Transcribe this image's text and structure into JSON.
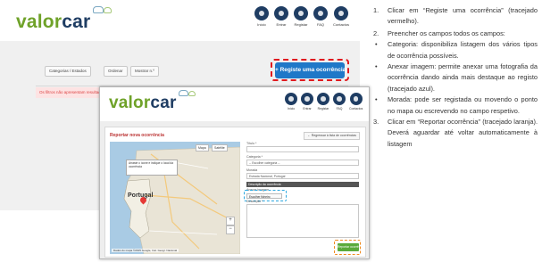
{
  "colors": {
    "logo_green": "#6fa229",
    "logo_navy": "#1f3d63",
    "register_button": "#1f78c8",
    "red_highlight": "#e0191f",
    "blue_highlight": "#2da8e0",
    "orange_highlight": "#f08a1c",
    "report_button": "#5aaa3c"
  },
  "screenshot_back": {
    "logo_left": "valor",
    "logo_right": "car",
    "nav": [
      {
        "label": "Início",
        "icon": "home-icon"
      },
      {
        "label": "Entrar",
        "icon": "login-icon"
      },
      {
        "label": "Registar",
        "icon": "register-icon"
      },
      {
        "label": "FAQ",
        "icon": "faq-icon"
      },
      {
        "label": "Contactos",
        "icon": "contact-icon"
      }
    ],
    "toolbar": {
      "categories": "Categorias / Estados",
      "order": "Ordenar",
      "show": "Mostrar n.º"
    },
    "register_button": "+ Registe uma ocorrência",
    "notice": "Os filtros não apresentam resultados"
  },
  "screenshot_front": {
    "logo_left": "valor",
    "logo_right": "car",
    "nav": [
      {
        "label": "Início",
        "icon": "home-icon"
      },
      {
        "label": "Entrar",
        "icon": "login-icon"
      },
      {
        "label": "Registar",
        "icon": "register-icon"
      },
      {
        "label": "FAQ",
        "icon": "faq-icon"
      },
      {
        "label": "Contactos",
        "icon": "contact-icon"
      }
    ],
    "panel_title": "Reportar nova ocorrência",
    "back_button": "← Regressar à lista de ocorrências",
    "map": {
      "map_button": "Mapa",
      "satellite_button": "Satélite",
      "tooltip": "Arraste o ícone e indique o local da ocorrência",
      "country_label": "Portugal",
      "footer": "Dados do mapa ©2015 Google, Inst. Geogr. Nacional"
    },
    "form": {
      "title_label": "Título *",
      "category_label": "Categoria *",
      "category_value": "-- Escolher categoria --",
      "address_label": "Morada",
      "address_value": "Estrada Nacional, Portugal",
      "section_bar": "Descrição da ocorrência",
      "image_label": "Anexar imagem",
      "photo_button": "Escolher ficheiro",
      "description_label": "Descrição *",
      "submit_button": "Reportar ocorrência"
    }
  },
  "instructions": [
    {
      "marker": "1.",
      "text": "Clicar em “Registe uma ocorrência” (tracejado vermelho)."
    },
    {
      "marker": "2.",
      "text": "Preencher os campos todos os campos:"
    },
    {
      "marker": "•",
      "text": "Categoria: disponibiliza listagem dos vários tipos de ocorrência possíveis."
    },
    {
      "marker": "•",
      "text": "Anexar imagem: permite anexar uma fotografia da ocorrência dando ainda mais destaque ao registo (tracejado azul)."
    },
    {
      "marker": "•",
      "text": "Morada: pode ser registada ou movendo o ponto no mapa ou escrevendo no campo respetivo."
    },
    {
      "marker": "3.",
      "text": "Clicar em “Reportar ocorrência” (tracejado laranja). Deverá aguardar até voltar automaticamente à listagem"
    }
  ]
}
